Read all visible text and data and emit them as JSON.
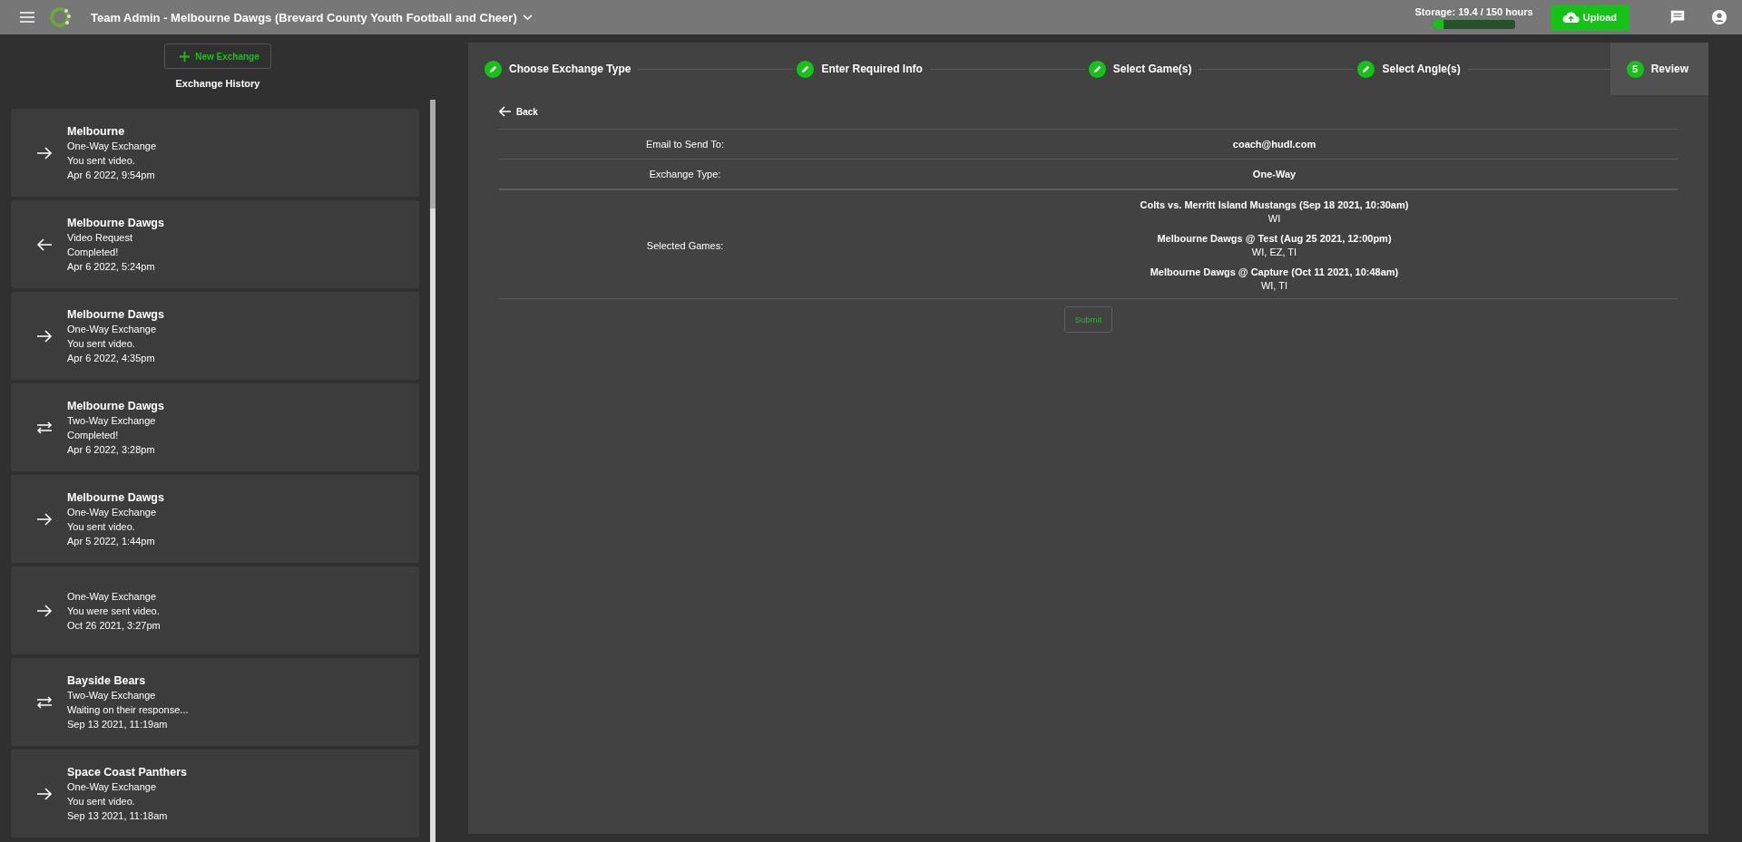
{
  "top_bar": {
    "title": "Team Admin - Melbourne Dawgs (Brevard County Youth Football and Cheer)",
    "storage": {
      "label": "Storage: 19.4 / 150 hours",
      "level": 0.13
    },
    "upload_button": "Upload"
  },
  "sidebar": {
    "new_button": "New Exchange",
    "heading": "Exchange History",
    "exchanges": [
      {
        "kind": "outgoing",
        "title": "Melbourne",
        "type": "One-Way Exchange",
        "status": "You sent video.",
        "date": "Apr 6 2022, 9:54pm"
      },
      {
        "kind": "incoming",
        "title": "Melbourne Dawgs",
        "type": "Video Request",
        "status": "Completed!",
        "date": "Apr 6 2022, 5:24pm"
      },
      {
        "kind": "outgoing",
        "title": "Melbourne Dawgs",
        "type": "One-Way Exchange",
        "status": "You sent video.",
        "date": "Apr 6 2022, 4:35pm"
      },
      {
        "kind": "two_way",
        "title": "Melbourne Dawgs",
        "type": "Two-Way Exchange",
        "status": "Completed!",
        "date": "Apr 6 2022, 3:28pm"
      },
      {
        "kind": "outgoing",
        "title": "Melbourne Dawgs",
        "type": "One-Way Exchange",
        "status": "You sent video.",
        "date": "Apr 5 2022, 1:44pm"
      },
      {
        "kind": "outgoing",
        "type": "One-Way Exchange",
        "status": "You were sent video.",
        "date": "Oct 26 2021, 3:27pm"
      },
      {
        "kind": "two_way",
        "title": "Bayside Bears",
        "type": "Two-Way Exchange",
        "status": "Waiting on their response...",
        "date": "Sep 13 2021, 11:19am"
      },
      {
        "kind": "outgoing",
        "title": "Space Coast Panthers",
        "type": "One-Way Exchange",
        "status": "You sent video.",
        "date": "Sep 13 2021, 11:18am"
      }
    ]
  },
  "stepper": {
    "steps": [
      {
        "label": "Choose Exchange Type",
        "completed": true,
        "selected": false
      },
      {
        "label": "Enter Required Info",
        "completed": true,
        "selected": false
      },
      {
        "label": "Select Game(s)",
        "completed": true,
        "selected": false
      },
      {
        "label": "Select Angle(s)",
        "completed": true,
        "selected": false
      },
      {
        "label": "Review",
        "number": "5",
        "completed": false,
        "selected": true
      }
    ]
  },
  "review": {
    "back": "Back",
    "rows": [
      {
        "kind": "text",
        "label": "Email to Send To:",
        "value": "coach@hudl.com"
      },
      {
        "kind": "text",
        "label": "Exchange Type:",
        "value": "One-Way"
      },
      {
        "kind": "games",
        "label": "Selected Games:",
        "games": [
          {
            "name": "Colts vs. Merritt Island Mustangs (Sep 18 2021, 10:30am)",
            "angles": "WI"
          },
          {
            "name": "Melbourne Dawgs @ Test (Aug 25 2021, 12:00pm)",
            "angles": "WI, EZ, TI"
          },
          {
            "name": "Melbourne Dawgs @ Capture (Oct 11 2021, 10:48am)",
            "angles": "WI, TI"
          }
        ]
      }
    ],
    "submit": "Submit"
  }
}
